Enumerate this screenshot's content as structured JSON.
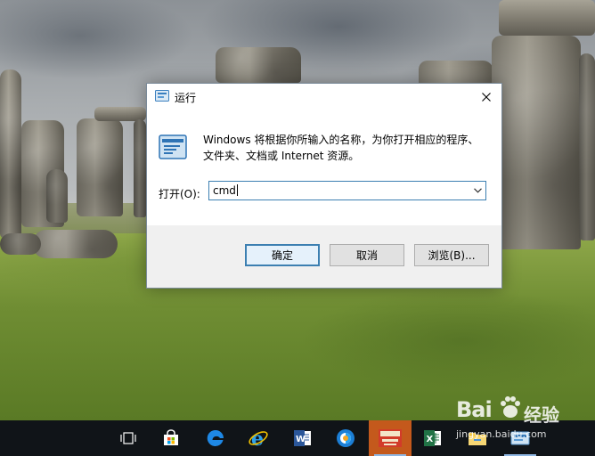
{
  "desktop": {
    "wallpaper": "stonehenge-landscape"
  },
  "run_dialog": {
    "title": "运行",
    "title_icon": "run-app-icon",
    "close_icon": "close-icon",
    "description": "Windows 将根据你所输入的名称，为你打开相应的程序、文件夹、文档或 Internet 资源。",
    "open_label": "打开(O):",
    "open_value": "cmd",
    "dropdown_icon": "chevron-down-icon",
    "buttons": {
      "ok": "确定",
      "cancel": "取消",
      "browse": "浏览(B)..."
    },
    "accent_color": "#3c7fb1"
  },
  "taskbar": {
    "items": [
      {
        "name": "task-view-icon",
        "running": false
      },
      {
        "name": "store-icon",
        "running": false
      },
      {
        "name": "edge-icon",
        "running": false
      },
      {
        "name": "internet-explorer-icon",
        "running": false
      },
      {
        "name": "word-icon",
        "running": false
      },
      {
        "name": "browser-icon",
        "running": false
      },
      {
        "name": "dictionary-app-icon",
        "running": true,
        "active": true
      },
      {
        "name": "excel-icon",
        "running": false
      },
      {
        "name": "file-explorer-icon",
        "running": false
      },
      {
        "name": "run-taskbar-icon",
        "running": true
      }
    ],
    "active_color": "#c4591c"
  },
  "watermark": {
    "logo": "Bai",
    "logo_suffix": "经验",
    "url": "jingyan.baidu.com"
  }
}
